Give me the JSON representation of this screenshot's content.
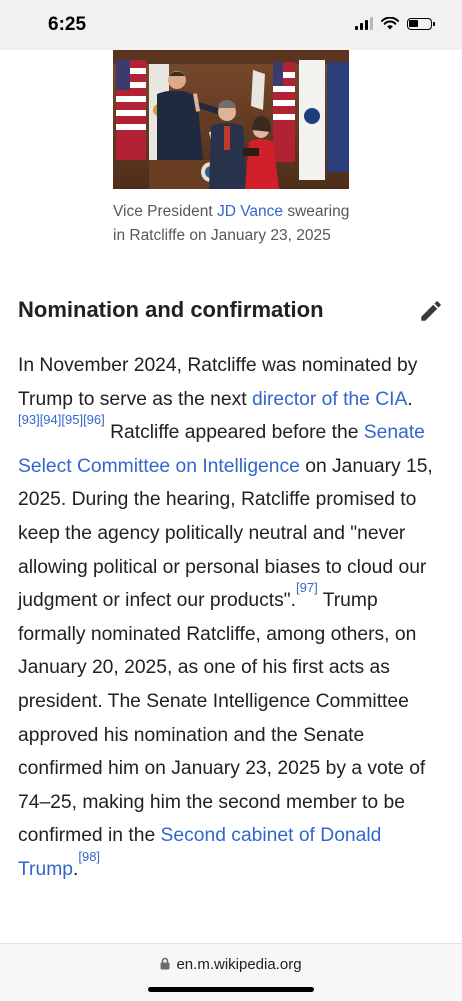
{
  "status_bar": {
    "time": "6:25"
  },
  "figure": {
    "caption_prefix": "Vice President ",
    "caption_link": "JD Vance",
    "caption_suffix": " swearing in Ratcliffe on January 23, 2025"
  },
  "section": {
    "heading": "Nomination and confirmation",
    "edit_icon": "pencil-icon"
  },
  "paragraph": {
    "t1": "In November 2024, Ratcliffe was nominated by Trump to serve as the next ",
    "link1": "director of the CIA",
    "t2": ".",
    "cite93": "[93]",
    "cite94": "[94]",
    "cite95": "[95]",
    "cite96": "[96]",
    "t3": " Ratcliffe appeared before the ",
    "link2": "Senate Select Committee on Intelligence",
    "t4": " on January 15, 2025. During the hearing, Ratcliffe promised to keep the agency politically neutral and \"never allowing political or personal biases to cloud our judgment or infect our products\".",
    "cite97": "[97]",
    "t5": " Trump formally nominated Ratcliffe, among others, on January 20, 2025, as one of his first acts as president. The Senate Intelligence Committee approved his nomination and the Senate confirmed him on January 23, 2025 by a vote of 74–25, making him the second member to be confirmed in the ",
    "link3": "Second cabinet of Donald Trump",
    "t6": ".",
    "cite98": "[98]"
  },
  "browser": {
    "url": "en.m.wikipedia.org",
    "lock_icon": "lock-icon"
  }
}
